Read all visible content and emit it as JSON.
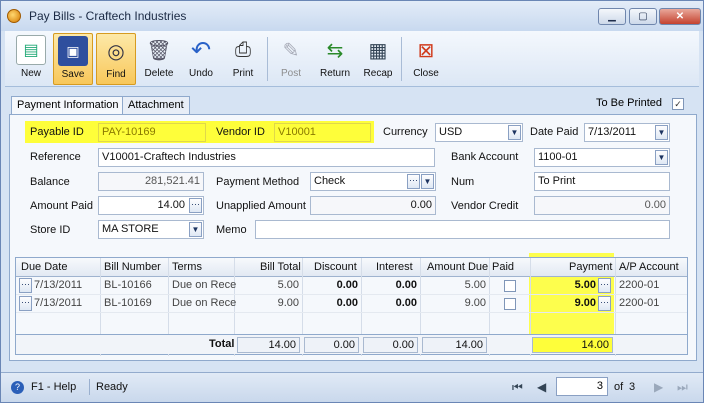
{
  "window": {
    "title": "Pay Bills - Craftech Industries"
  },
  "toolbar": {
    "new": "New",
    "save": "Save",
    "find": "Find",
    "delete": "Delete",
    "undo": "Undo",
    "print": "Print",
    "post": "Post",
    "return": "Return",
    "recap": "Recap",
    "close": "Close"
  },
  "tabs": {
    "payment": "Payment Information",
    "attachment": "Attachment"
  },
  "to_be_printed": {
    "label": "To Be Printed",
    "checked": "✓"
  },
  "form": {
    "payable_id_label": "Payable ID",
    "payable_id": "PAY-10169",
    "vendor_id_label": "Vendor ID",
    "vendor_id": "V10001",
    "currency_label": "Currency",
    "currency": "USD",
    "date_paid_label": "Date Paid",
    "date_paid": "7/13/2011",
    "reference_label": "Reference",
    "reference": "V10001-Craftech Industries",
    "bank_account_label": "Bank Account",
    "bank_account": "1100-01",
    "balance_label": "Balance",
    "balance": "281,521.41",
    "payment_method_label": "Payment Method",
    "payment_method": "Check",
    "num_label": "Num",
    "num": "To Print",
    "amount_paid_label": "Amount Paid",
    "amount_paid": "14.00",
    "unapplied_label": "Unapplied Amount",
    "unapplied": "0.00",
    "vendor_credit_label": "Vendor Credit",
    "vendor_credit": "0.00",
    "store_id_label": "Store ID",
    "store_id": "MA STORE",
    "memo_label": "Memo",
    "memo": ""
  },
  "grid": {
    "headers": {
      "due_date": "Due Date",
      "bill_number": "Bill Number",
      "terms": "Terms",
      "bill_total": "Bill Total",
      "discount": "Discount",
      "interest": "Interest",
      "amount_due": "Amount Due",
      "paid": "Paid",
      "payment": "Payment",
      "ap_account": "A/P Account"
    },
    "rows": [
      {
        "due_date": "7/13/2011",
        "bill_number": "BL-10166",
        "terms": "Due on Rece",
        "bill_total": "5.00",
        "discount": "0.00",
        "interest": "0.00",
        "amount_due": "5.00",
        "payment": "5.00",
        "ap_account": "2200-01"
      },
      {
        "due_date": "7/13/2011",
        "bill_number": "BL-10169",
        "terms": "Due on Rece",
        "bill_total": "9.00",
        "discount": "0.00",
        "interest": "0.00",
        "amount_due": "9.00",
        "payment": "9.00",
        "ap_account": "2200-01"
      }
    ],
    "totals": {
      "label": "Total",
      "bill_total": "14.00",
      "discount": "0.00",
      "interest": "0.00",
      "amount_due": "14.00",
      "payment": "14.00"
    }
  },
  "status": {
    "help": "F1 - Help",
    "state": "Ready",
    "page": "3",
    "of_label": "of",
    "total_pages": "3"
  },
  "colors": {
    "highlight": "#fefe3a",
    "accent": "#d6e3f3"
  }
}
